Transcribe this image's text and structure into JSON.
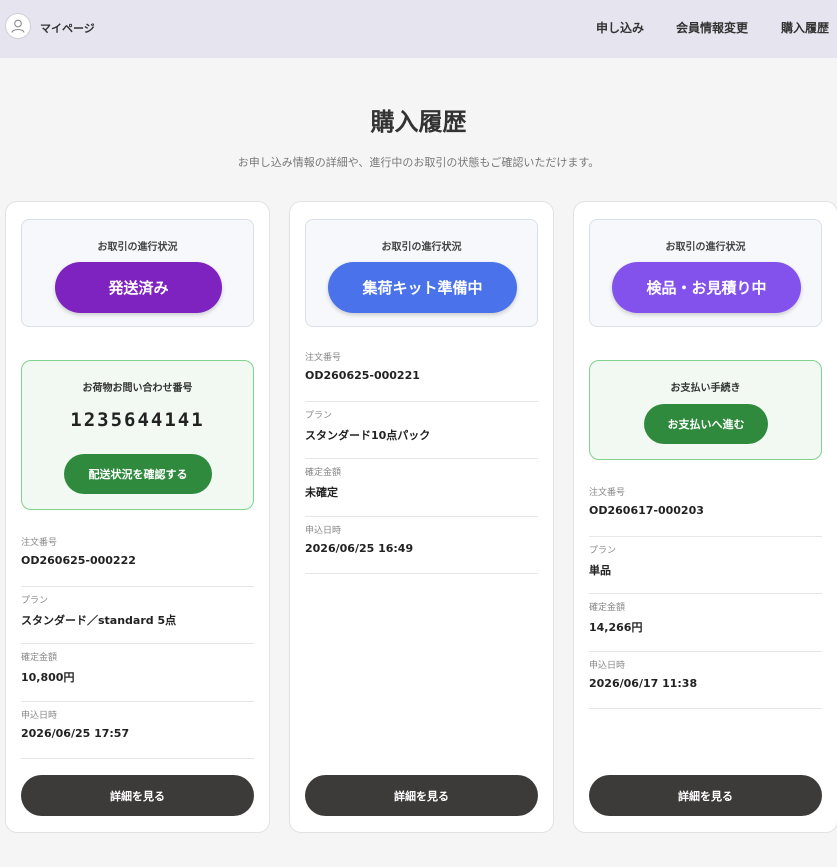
{
  "header": {
    "brand": "マイページ",
    "nav": [
      "申し込み",
      "会員情報変更",
      "購入履歴"
    ]
  },
  "page": {
    "title": "購入履歴",
    "subtitle": "お申し込み情報の詳細や、進行中のお取引の状態もご確認いただけます。"
  },
  "labels": {
    "status_label": "お取引の進行状況",
    "order_no": "注文番号",
    "plan": "プラン",
    "amount": "確定金額",
    "applied_at": "申込日時",
    "detail_button": "詳細を見る"
  },
  "orders": [
    {
      "status": "発送済み",
      "tracking_label": "お荷物お問い合わせ番号",
      "tracking_number": "1235644141",
      "tracking_button": "配送状況を確認する",
      "order_no": "OD260625-000222",
      "plan": "スタンダード／standard 5点",
      "amount": "10,800円",
      "applied_at": "2026/06/25 17:57"
    },
    {
      "status": "集荷キット準備中",
      "order_no": "OD260625-000221",
      "plan": "スタンダード10点パック",
      "amount": "未確定",
      "applied_at": "2026/06/25 16:49"
    },
    {
      "status": "検品・お見積り中",
      "payment_label": "お支払い手続き",
      "payment_button": "お支払いへ進む",
      "order_no": "OD260617-000203",
      "plan": "単品",
      "amount": "14,266円",
      "applied_at": "2026/06/17 11:38"
    }
  ],
  "colors": {
    "header_bg": "#e6e4ef",
    "status_shipped": "#7e22c0",
    "status_kit": "#4a72ea",
    "status_inspection": "#8352ec",
    "green_button": "#2f8a3d",
    "detail_button": "#3d3a3a"
  }
}
